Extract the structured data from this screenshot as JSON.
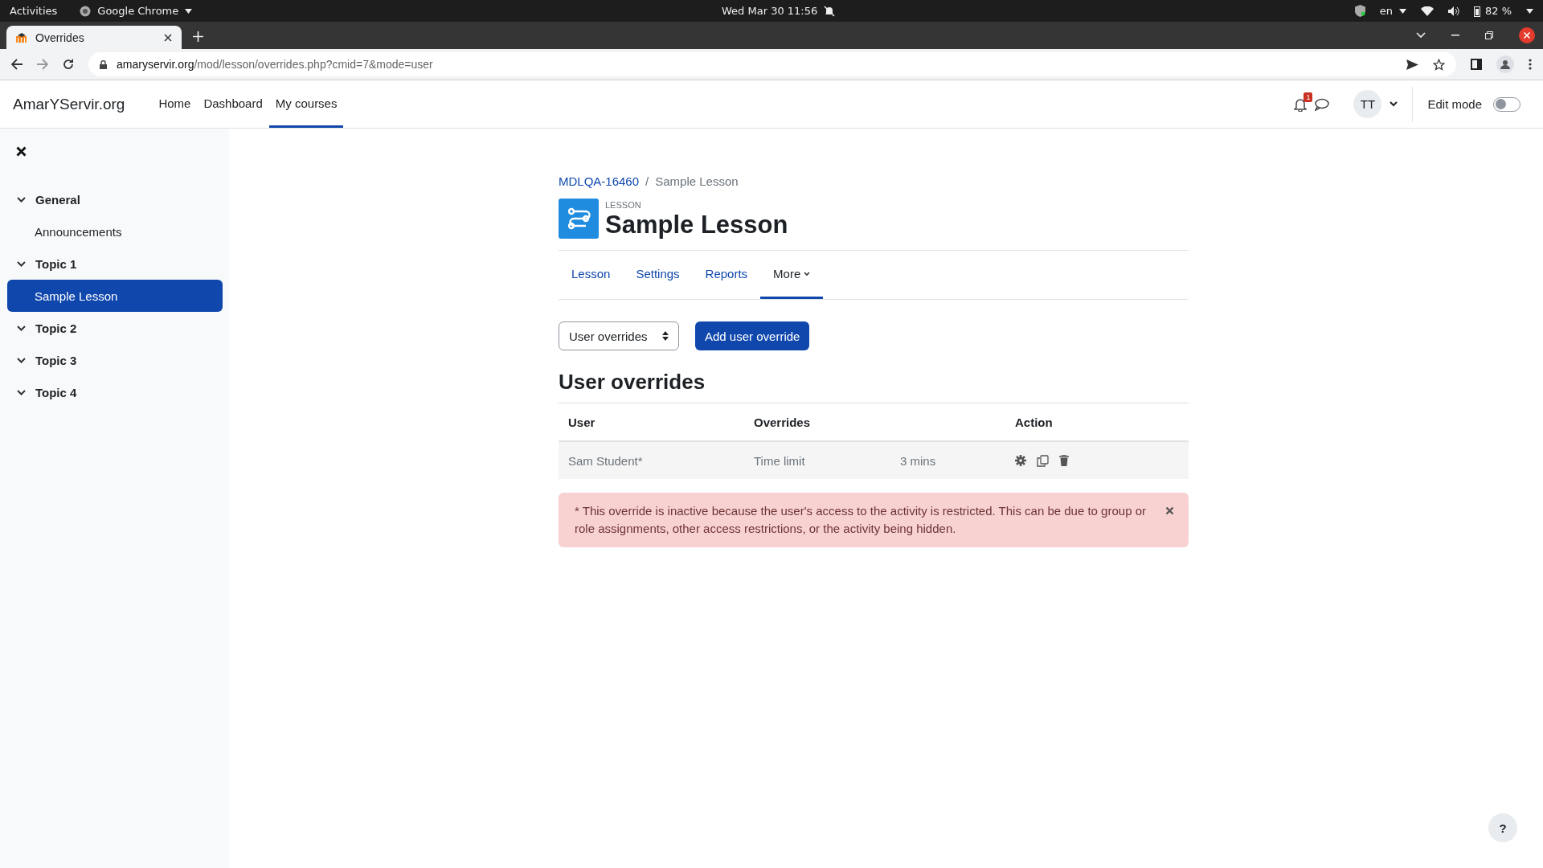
{
  "system_bar": {
    "activities": "Activities",
    "app": "Google Chrome",
    "clock": "Wed Mar 30  11:56",
    "language": "en",
    "battery": "82 %"
  },
  "browser": {
    "tab_title": "Overrides",
    "url_host": "amaryservir.org",
    "url_path": "/mod/lesson/overrides.php?cmid=7&mode=user"
  },
  "navbar": {
    "brand": "AmarYServir.org",
    "items": [
      {
        "label": "Home",
        "selected": false
      },
      {
        "label": "Dashboard",
        "selected": false
      },
      {
        "label": "My courses",
        "selected": true
      }
    ],
    "notification_count": "1",
    "avatar": "TT",
    "edit_mode": {
      "label": "Edit mode",
      "on": false
    }
  },
  "sidebar": {
    "sections": [
      {
        "title": "General",
        "expanded": true,
        "children": [
          {
            "label": "Announcements",
            "selected": false
          }
        ]
      },
      {
        "title": "Topic 1",
        "expanded": true,
        "children": [
          {
            "label": "Sample Lesson",
            "selected": true
          }
        ]
      },
      {
        "title": "Topic 2",
        "expanded": true
      },
      {
        "title": "Topic 3",
        "expanded": true
      },
      {
        "title": "Topic 4",
        "expanded": true
      }
    ]
  },
  "breadcrumb_separator": "/",
  "breadcrumb": [
    {
      "label": "MDLQA-16460",
      "kind": "link"
    },
    {
      "label": "Sample Lesson",
      "kind": "current"
    }
  ],
  "header": {
    "kicker": "LESSON",
    "title": "Sample Lesson"
  },
  "tabs": [
    {
      "label": "Lesson",
      "selected": false,
      "kind": "link"
    },
    {
      "label": "Settings",
      "selected": false,
      "kind": "link"
    },
    {
      "label": "Reports",
      "selected": false,
      "kind": "link"
    },
    {
      "label": "More",
      "selected": true,
      "kind": "menu"
    }
  ],
  "mode_select": {
    "value": "User overrides"
  },
  "add_button": "Add user override",
  "section_title": "User overrides",
  "table": {
    "columns": [
      "User",
      "Overrides",
      "Action"
    ],
    "rows": [
      {
        "user": "Sam Student*",
        "setting": "Time limit",
        "value": "3 mins"
      }
    ]
  },
  "alert": {
    "text": "* This override is inactive because the user's access to the activity is restricted. This can be due to group or role assignments, other access restrictions, or the activity being hidden."
  },
  "help_button": "?"
}
